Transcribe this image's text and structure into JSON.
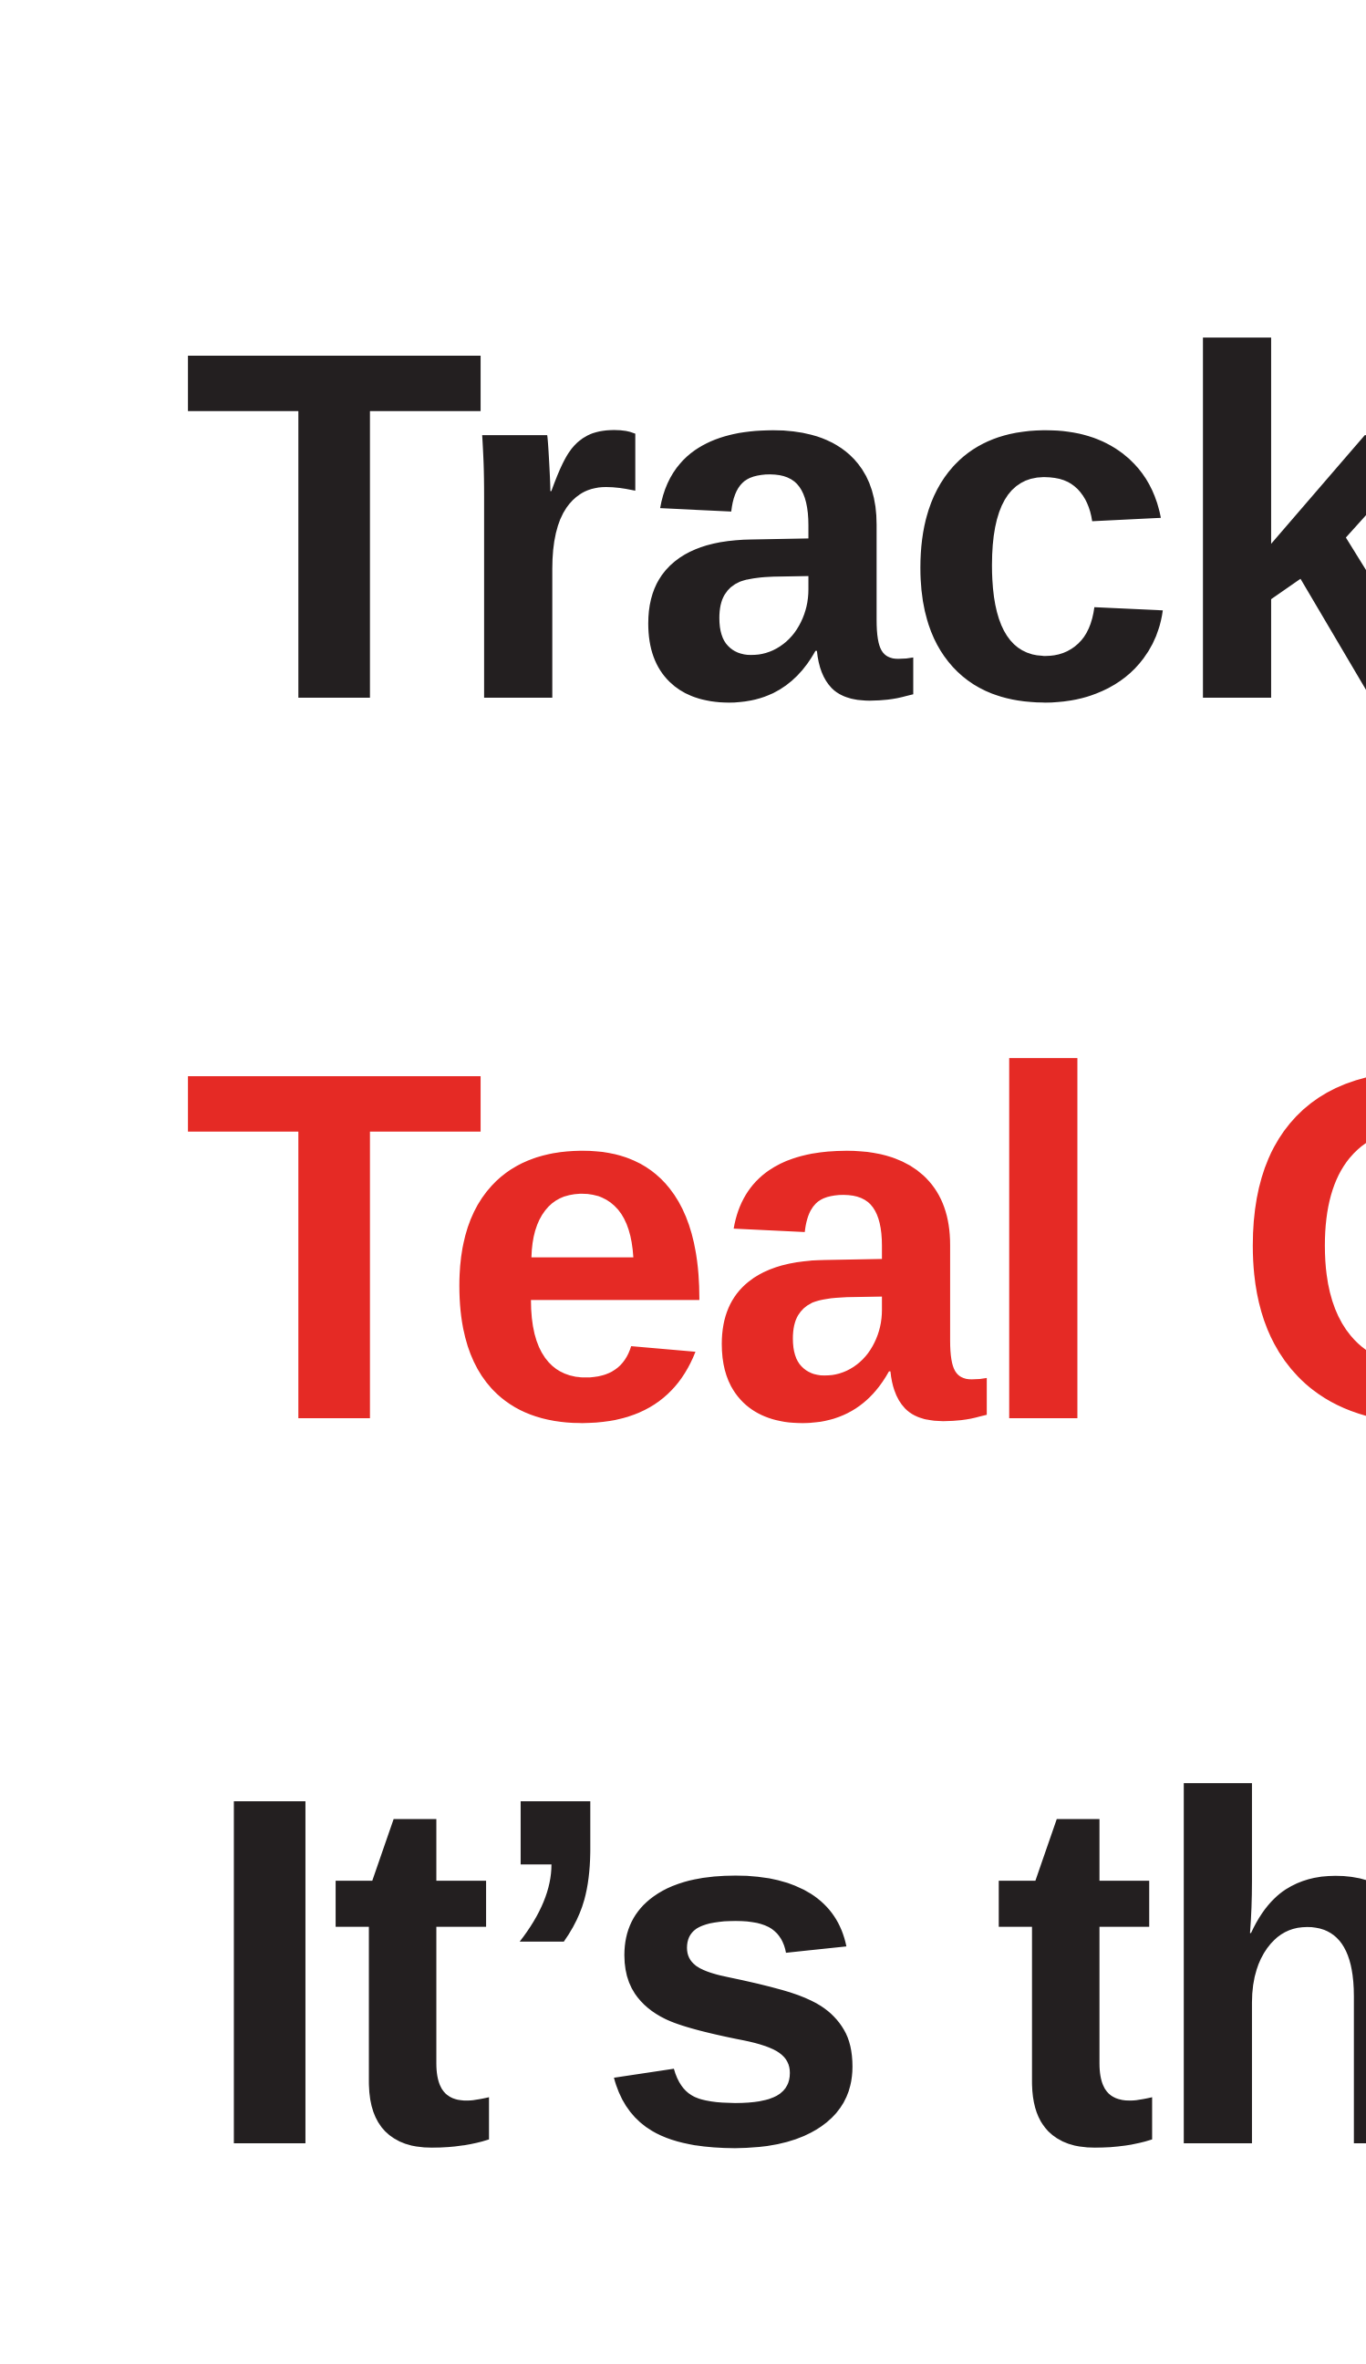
{
  "lines": [
    {
      "text": "Track",
      "color": "#231f20"
    },
    {
      "text": "Teal C",
      "color": "#e52a25"
    },
    {
      "text": "It’s thr",
      "color": "#231f20"
    }
  ]
}
